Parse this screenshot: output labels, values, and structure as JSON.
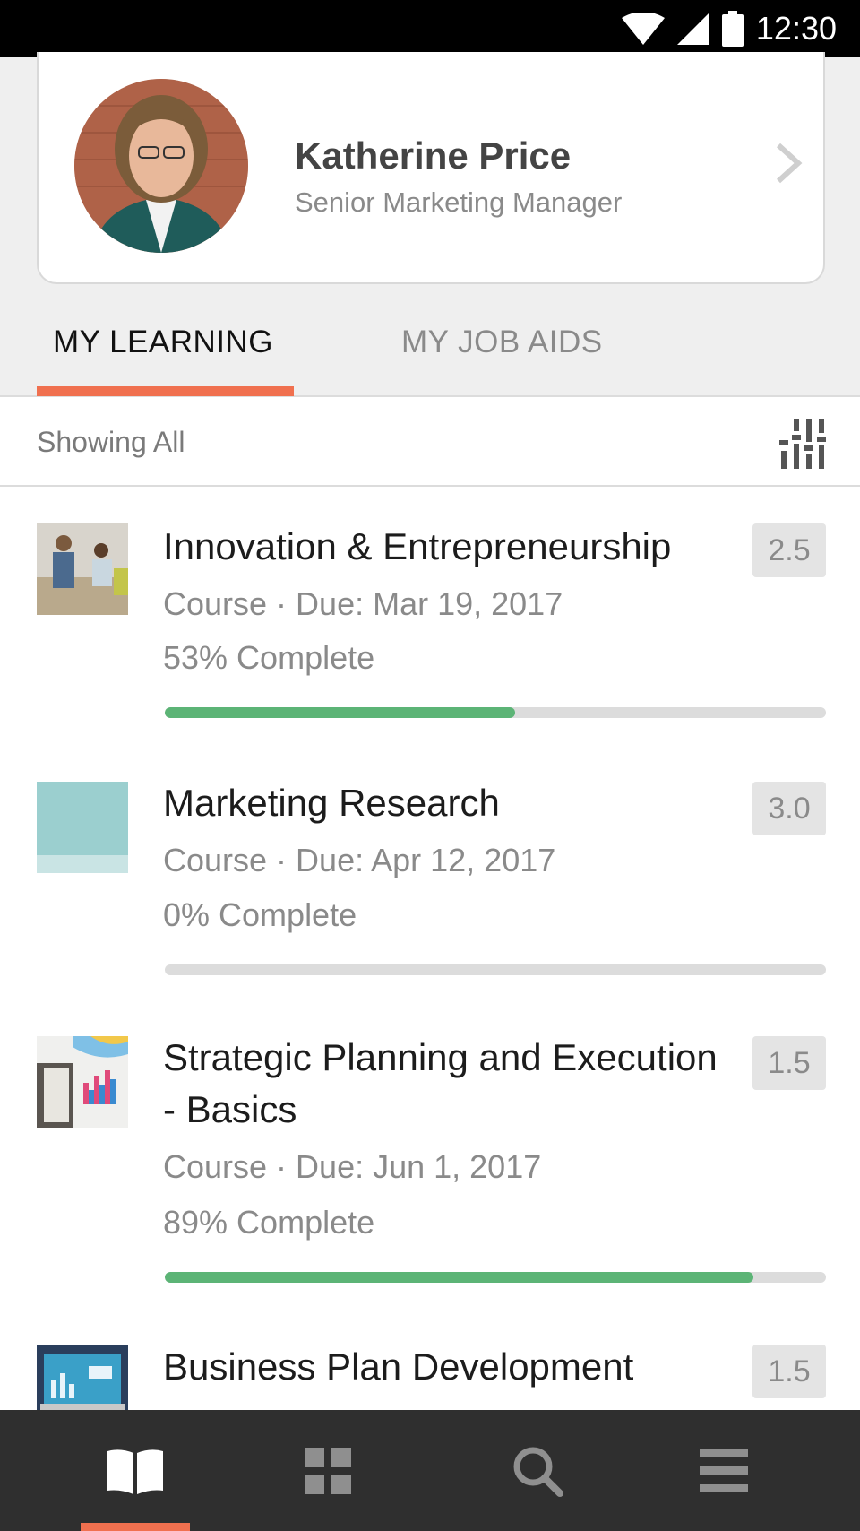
{
  "status_bar": {
    "time": "12:30",
    "icons": [
      "wifi-icon",
      "signal-icon",
      "battery-icon"
    ]
  },
  "profile": {
    "name": "Katherine Price",
    "title": "Senior Marketing Manager"
  },
  "tabs": [
    {
      "label": "MY LEARNING",
      "active": true
    },
    {
      "label": "MY JOB AIDS",
      "active": false
    }
  ],
  "filter": {
    "label": "Showing All",
    "icon": "filter-sliders-icon"
  },
  "courses": [
    {
      "title": "Innovation & Entrepreneurship",
      "meta": "Course · Due: Mar 19, 2017",
      "progress_text": "53% Complete",
      "progress": 0.53,
      "credits": "2.5"
    },
    {
      "title": "Marketing Research",
      "meta": "Course · Due: Apr 12, 2017",
      "progress_text": "0% Complete",
      "progress": 0.0,
      "credits": "3.0"
    },
    {
      "title": "Strategic Planning and Execution - Basics",
      "meta": "Course · Due: Jun 1, 2017",
      "progress_text": "89% Complete",
      "progress": 0.89,
      "credits": "1.5"
    },
    {
      "title": "Business Plan Development",
      "meta": "",
      "progress_text": "",
      "credits": "1.5"
    }
  ],
  "bottom_nav": {
    "items": [
      "book-icon",
      "grid-icon",
      "search-icon",
      "menu-icon"
    ],
    "active": "book-icon"
  },
  "colors": {
    "accent": "#f0704f",
    "progress": "#5cb476",
    "nav_background": "#2f2f2f"
  }
}
